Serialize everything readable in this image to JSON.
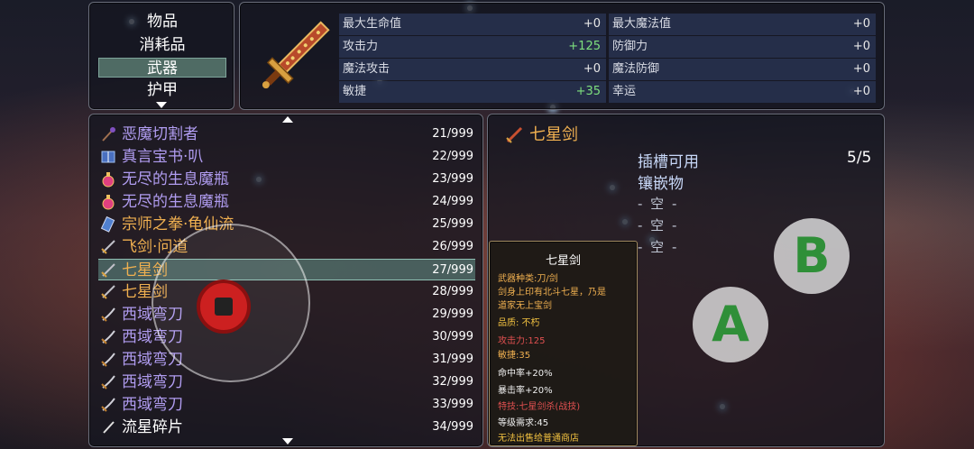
{
  "categories": {
    "items": [
      "物品",
      "消耗品",
      "武器",
      "护甲"
    ],
    "selected": "武器"
  },
  "stats": {
    "left": [
      {
        "label": "最大生命值",
        "value": "+0",
        "highlight": false
      },
      {
        "label": "攻击力",
        "value": "+125",
        "highlight": true
      },
      {
        "label": "魔法攻击",
        "value": "+0",
        "highlight": false
      },
      {
        "label": "敏捷",
        "value": "+35",
        "highlight": true
      }
    ],
    "right": [
      {
        "label": "最大魔法值",
        "value": "+0"
      },
      {
        "label": "防御力",
        "value": "+0"
      },
      {
        "label": "魔法防御",
        "value": "+0"
      },
      {
        "label": "幸运",
        "value": "+0"
      }
    ]
  },
  "items": [
    {
      "name": "恶魔切割者",
      "count": "21/999",
      "color": "purple",
      "icon": "staff-icon"
    },
    {
      "name": "真言宝书·叭",
      "count": "22/999",
      "color": "purple",
      "icon": "book-icon"
    },
    {
      "name": "无尽的生息魔瓶",
      "count": "23/999",
      "color": "purple",
      "icon": "potion-icon"
    },
    {
      "name": "无尽的生息魔瓶",
      "count": "24/999",
      "color": "purple",
      "icon": "potion-icon"
    },
    {
      "name": "宗师之拳·龟仙流",
      "count": "25/999",
      "color": "orange",
      "icon": "scroll-icon"
    },
    {
      "name": "飞剑·问道",
      "count": "26/999",
      "color": "orange",
      "icon": "sword-icon"
    },
    {
      "name": "七星剑",
      "count": "27/999",
      "color": "orange",
      "icon": "sword-icon",
      "selected": true
    },
    {
      "name": "七星剑",
      "count": "28/999",
      "color": "orange",
      "icon": "sword-icon"
    },
    {
      "name": "西域弯刀",
      "count": "29/999",
      "color": "purple",
      "icon": "scimitar-icon"
    },
    {
      "name": "西域弯刀",
      "count": "30/999",
      "color": "purple",
      "icon": "scimitar-icon"
    },
    {
      "name": "西域弯刀",
      "count": "31/999",
      "color": "purple",
      "icon": "scimitar-icon"
    },
    {
      "name": "西域弯刀",
      "count": "32/999",
      "color": "purple",
      "icon": "scimitar-icon"
    },
    {
      "name": "西域弯刀",
      "count": "33/999",
      "color": "purple",
      "icon": "scimitar-icon"
    },
    {
      "name": "流星碎片",
      "count": "34/999",
      "color": "white",
      "icon": "shard-icon"
    }
  ],
  "detail": {
    "title": "七星剑",
    "slots_label": "插槽可用",
    "slots_value": "5/5",
    "inlay_label": "镶嵌物",
    "empty_slots": [
      "- 空 -",
      "- 空 -",
      "- 空 -"
    ]
  },
  "tooltip": {
    "title": "七星剑",
    "lines": [
      {
        "text": "武器种类:刀/剑",
        "style": "o"
      },
      {
        "text": "剑身上印有北斗七星，乃是",
        "style": "o"
      },
      {
        "text": "道家无上宝剑",
        "style": "o"
      },
      {
        "text": "品质: 不朽",
        "style": "y"
      },
      {
        "text": "攻击力:125",
        "style": "r"
      },
      {
        "text": "敏捷:35",
        "style": "o"
      },
      {
        "text": "命中率+20%",
        "style": "w"
      },
      {
        "text": "暴击率+20%",
        "style": "w"
      },
      {
        "text": "特技:七星剑杀(战技)",
        "style": "r"
      },
      {
        "text": "等级需求:45",
        "style": "w"
      },
      {
        "text": "无法出售给普通商店",
        "style": "y"
      }
    ]
  },
  "controls": {
    "a_label": "A",
    "b_label": "B"
  }
}
